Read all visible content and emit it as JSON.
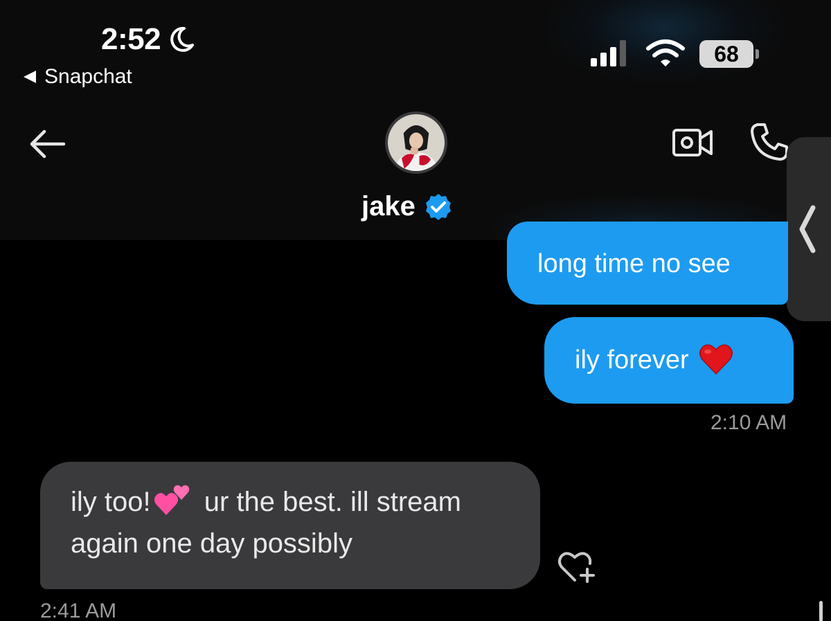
{
  "status_bar": {
    "time": "2:52",
    "back_app": "Snapchat",
    "battery": "68",
    "icons": [
      "moon-icon",
      "signal-icon",
      "wifi-icon",
      "battery-icon"
    ]
  },
  "header": {
    "contact_name": "jake",
    "verified": true,
    "icons": [
      "back-arrow-icon",
      "avatar",
      "verified-icon",
      "video-call-icon",
      "phone-call-icon"
    ]
  },
  "messages": [
    {
      "direction": "outgoing",
      "text": "long time no see"
    },
    {
      "direction": "outgoing",
      "text": "ily forever",
      "emoji": "red-heart"
    },
    {
      "direction": "outgoing_timestamp",
      "text": "2:10 AM"
    },
    {
      "direction": "incoming",
      "text_before": "ily too!",
      "emoji": "two-hearts",
      "text_after": " ur the best. ill stream again one day possibly"
    },
    {
      "direction": "incoming_timestamp",
      "text": "2:41 AM"
    }
  ],
  "colors": {
    "background": "#000000",
    "header": "#0b0b0b",
    "outgoing_bubble": "#1d9bf0",
    "incoming_bubble": "#3a3a3c",
    "timestamp": "#9b9b9b",
    "verified": "#1d9bf0"
  }
}
